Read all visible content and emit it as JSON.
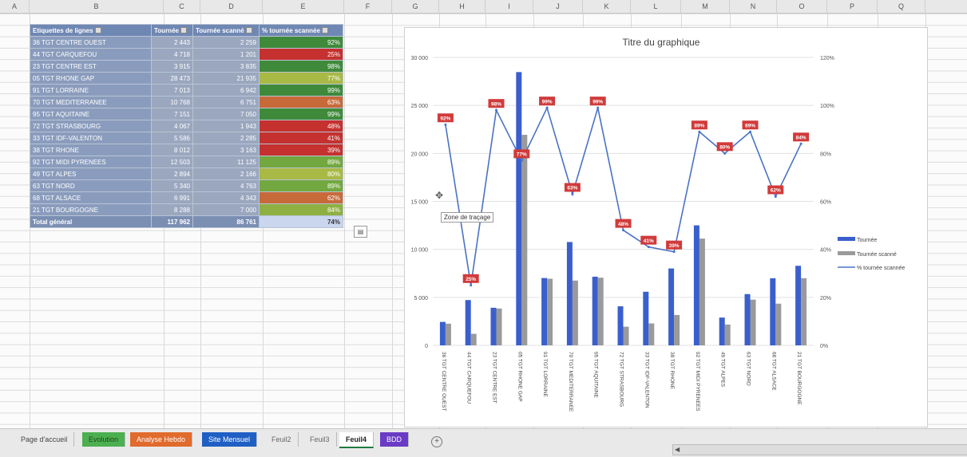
{
  "columns": [
    "A",
    "B",
    "C",
    "D",
    "E",
    "F",
    "G",
    "H",
    "I",
    "J",
    "K",
    "L",
    "M",
    "N",
    "O",
    "P",
    "Q"
  ],
  "pivot": {
    "headers": [
      "Etiquettes de lignes",
      "Tournée",
      "Tournée scanné",
      "% tournée scannée"
    ],
    "rows": [
      {
        "label": "36 TGT CENTRE OUEST",
        "tournee": "2 443",
        "scanne": "2 259",
        "pct": "92%",
        "color": "#3f8a3a"
      },
      {
        "label": "44 TGT CARQUEFOU",
        "tournee": "4 718",
        "scanne": "1 201",
        "pct": "25%",
        "color": "#c4312f"
      },
      {
        "label": "23 TGT CENTRE EST",
        "tournee": "3 915",
        "scanne": "3 835",
        "pct": "98%",
        "color": "#3f8a3a"
      },
      {
        "label": "05 TGT RHONE GAP",
        "tournee": "28 473",
        "scanne": "21 935",
        "pct": "77%",
        "color": "#a9b945"
      },
      {
        "label": "91 TGT LORRAINE",
        "tournee": "7 013",
        "scanne": "6 942",
        "pct": "99%",
        "color": "#3f8a3a"
      },
      {
        "label": "70 TGT MEDITERRANEE",
        "tournee": "10 768",
        "scanne": "6 751",
        "pct": "63%",
        "color": "#c76a3a"
      },
      {
        "label": "95 TGT AQUITAINE",
        "tournee": "7 151",
        "scanne": "7 050",
        "pct": "99%",
        "color": "#3f8a3a"
      },
      {
        "label": "72 TGT STRASBOURG",
        "tournee": "4 067",
        "scanne": "1 943",
        "pct": "48%",
        "color": "#c4312f"
      },
      {
        "label": "33 TGT IDF-VALENTON",
        "tournee": "5 586",
        "scanne": "2 285",
        "pct": "41%",
        "color": "#c4312f"
      },
      {
        "label": "38 TGT RHONE",
        "tournee": "8 012",
        "scanne": "3 163",
        "pct": "39%",
        "color": "#c4312f"
      },
      {
        "label": "92 TGT MIDI PYRENEES",
        "tournee": "12 503",
        "scanne": "11 125",
        "pct": "89%",
        "color": "#72a83f"
      },
      {
        "label": "49 TGT ALPES",
        "tournee": "2 894",
        "scanne": "2 166",
        "pct": "80%",
        "color": "#a9b945"
      },
      {
        "label": "63 TGT NORD",
        "tournee": "5 340",
        "scanne": "4 763",
        "pct": "89%",
        "color": "#72a83f"
      },
      {
        "label": "68 TGT ALSACE",
        "tournee": "6 991",
        "scanne": "4 343",
        "pct": "62%",
        "color": "#c76a3a"
      },
      {
        "label": "21 TGT BOURGOGNE",
        "tournee": "8 288",
        "scanne": "7 000",
        "pct": "84%",
        "color": "#8eb043"
      }
    ],
    "total": {
      "label": "Total général",
      "tournee": "117 962",
      "scanne": "86 761",
      "pct": "74%"
    }
  },
  "chart_data": {
    "type": "bar",
    "title": "Titre du graphique",
    "categories": [
      "36 TGT CENTRE OUEST",
      "44 TGT CARQUEFOU",
      "23 TGT CENTRE EST",
      "05 TGT RHONE GAP",
      "91 TGT LORRAINE",
      "70 TGT MEDITERRANEE",
      "95 TGT AQUITAINE",
      "72 TGT STRASBOURG",
      "33 TGT IDF-VALENTON",
      "38 TGT RHONE",
      "92 TGT MIDI PYRENEES",
      "49 TGT ALPES",
      "63 TGT NORD",
      "68 TGT ALSACE",
      "21 TGT BOURGOGNE"
    ],
    "series": [
      {
        "name": "Tournée",
        "type": "bar",
        "axis": "left",
        "color": "#3a5fcd",
        "values": [
          2443,
          4718,
          3915,
          28473,
          7013,
          10768,
          7151,
          4067,
          5586,
          8012,
          12503,
          2894,
          5340,
          6991,
          8288
        ]
      },
      {
        "name": "Tournée scanné",
        "type": "bar",
        "axis": "left",
        "color": "#9a9a9a",
        "values": [
          2259,
          1201,
          3835,
          21935,
          6942,
          6751,
          7050,
          1943,
          2285,
          3163,
          11125,
          2166,
          4763,
          4343,
          7000
        ]
      },
      {
        "name": "% tournée scannée",
        "type": "line",
        "axis": "right",
        "color": "#4a72c4",
        "values": [
          92,
          25,
          98,
          77,
          99,
          63,
          99,
          48,
          41,
          39,
          89,
          80,
          89,
          62,
          84
        ],
        "labels": [
          "92%",
          "25%",
          "98%",
          "77%",
          "99%",
          "63%",
          "99%",
          "48%",
          "41%",
          "39%",
          "89%",
          "80%",
          "89%",
          "62%",
          "84%"
        ]
      }
    ],
    "ylim": [
      0,
      30000
    ],
    "yticks": [
      "0",
      "5 000",
      "10 000",
      "15 000",
      "20 000",
      "25 000",
      "30 000"
    ],
    "y2lim": [
      0,
      120
    ],
    "y2ticks": [
      "0%",
      "20%",
      "40%",
      "60%",
      "80%",
      "100%",
      "120%"
    ],
    "legend": "right",
    "grid": true
  },
  "tooltip": "Zone de traçage",
  "tabs": [
    {
      "label": "Page d'accueil",
      "bg": "#e9e9e9",
      "fg": "#444"
    },
    {
      "label": "Evolution",
      "bg": "#4caf50",
      "fg": "#1c4a1c"
    },
    {
      "label": "Analyse Hebdo",
      "bg": "#e06b2d",
      "fg": "#ffffff"
    },
    {
      "label": "Site Mensuel",
      "bg": "#1f5fc4",
      "fg": "#ffffff"
    },
    {
      "label": "Feuil2",
      "bg": "#e9e9e9",
      "fg": "#666"
    },
    {
      "label": "Feuil3",
      "bg": "#e9e9e9",
      "fg": "#666"
    },
    {
      "label": "Feuil4",
      "bg": "#ffffff",
      "fg": "#222"
    },
    {
      "label": "BDD",
      "bg": "#6a3bc4",
      "fg": "#ffffff"
    }
  ]
}
